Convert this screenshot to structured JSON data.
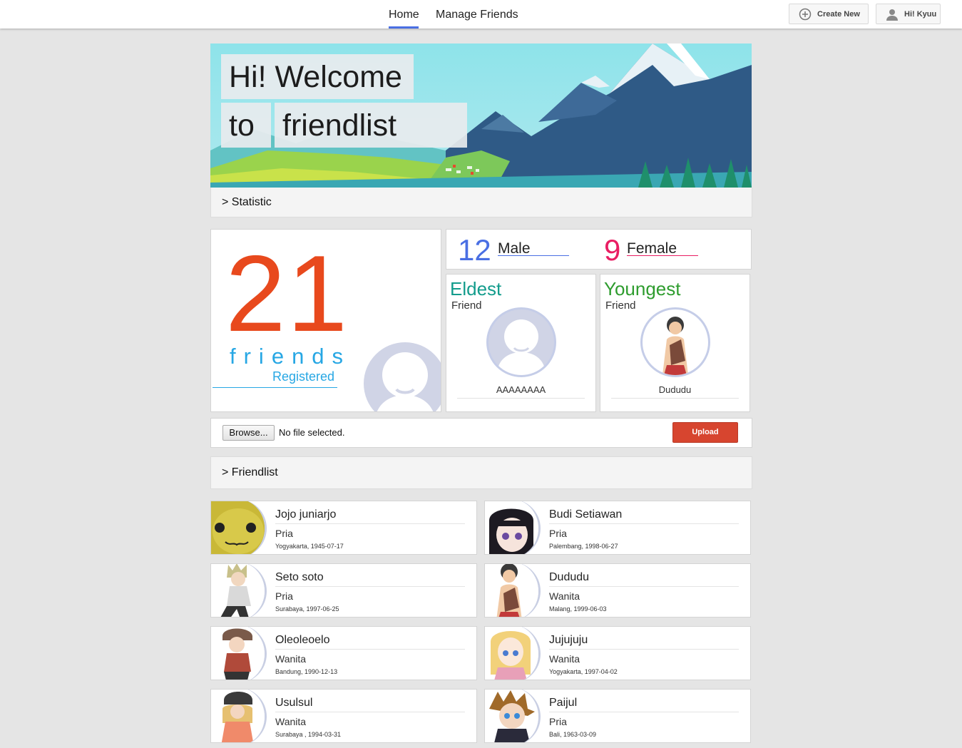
{
  "nav": {
    "home": "Home",
    "manage": "Manage Friends",
    "create_new": "Create New",
    "user_greeting": "Hi! Kyuu"
  },
  "hero": {
    "line1": "Hi! Welcome",
    "line2a": "to",
    "line2b": "friendlist"
  },
  "sections": {
    "statistic": "> Statistic",
    "friendlist": "> Friendlist"
  },
  "stats": {
    "total": "21",
    "total_label": "friends",
    "registered": "Registered",
    "male_count": "12",
    "male_label": "Male",
    "female_count": "9",
    "female_label": "Female",
    "eldest_title": "Eldest",
    "eldest_sub": "Friend",
    "eldest_name": "AAAAAAAA",
    "youngest_title": "Youngest",
    "youngest_sub": "Friend",
    "youngest_name": "Dududu"
  },
  "upload": {
    "browse": "Browse...",
    "status": "No file selected.",
    "button": "Upload"
  },
  "friends": [
    {
      "name": "Jojo juniarjo",
      "gender": "Pria",
      "born": "Yogyakarta, 1945-07-17"
    },
    {
      "name": "Budi Setiawan",
      "gender": "Pria",
      "born": "Palembang, 1998-06-27"
    },
    {
      "name": "Seto soto",
      "gender": "Pria",
      "born": "Surabaya, 1997-06-25"
    },
    {
      "name": "Dududu",
      "gender": "Wanita",
      "born": "Malang, 1999-06-03"
    },
    {
      "name": "Oleoleoelo",
      "gender": "Wanita",
      "born": "Bandung, 1990-12-13"
    },
    {
      "name": "Jujujuju",
      "gender": "Wanita",
      "born": "Yogyakarta, 1997-04-02"
    },
    {
      "name": "Usulsul",
      "gender": "Wanita",
      "born": "Surabaya , 1994-03-31"
    },
    {
      "name": "Paijul",
      "gender": "Pria",
      "born": "Bali, 1963-03-09"
    }
  ],
  "colors": {
    "accent_blue": "#4a6fe3",
    "total_orange": "#e8491d",
    "friends_blue": "#27a7e4",
    "male_blue": "#4a6fe3",
    "female_pink": "#e91e63",
    "eldest_teal": "#139c8c",
    "youngest_green": "#2e9c2e",
    "upload_red": "#d7452f"
  }
}
